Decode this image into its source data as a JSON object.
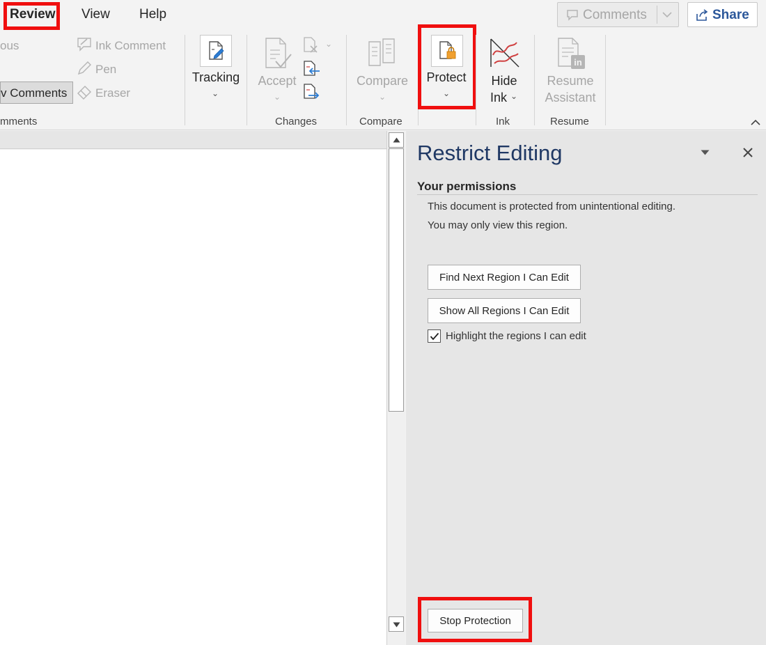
{
  "ribbon": {
    "tabs": {
      "review": "Review",
      "view": "View",
      "help": "Help"
    },
    "comments_button": "Comments",
    "share_button": "Share",
    "comments_group": {
      "prev_partial": "ous",
      "show_comments_partial": "v Comments",
      "ink_comment": "Ink Comment",
      "pen": "Pen",
      "eraser": "Eraser",
      "label_partial": "mments"
    },
    "tracking": {
      "label": "Tracking"
    },
    "changes": {
      "accept": "Accept",
      "label": "Changes"
    },
    "compare": {
      "button": "Compare",
      "label": "Compare"
    },
    "protect": {
      "button": "Protect"
    },
    "ink": {
      "hide_line1": "Hide",
      "hide_line2": "Ink",
      "label": "Ink"
    },
    "resume": {
      "line1": "Resume",
      "line2": "Assistant",
      "label": "Resume"
    }
  },
  "pane": {
    "title": "Restrict Editing",
    "subtitle": "Your permissions",
    "text1": "This document is protected from unintentional editing.",
    "text2": "You may only view this region.",
    "find_next_button": "Find Next Region I Can Edit",
    "show_all_button": "Show All Regions I Can Edit",
    "highlight_label": "Highlight the regions I can edit",
    "highlight_checked": true,
    "stop_button": "Stop Protection"
  },
  "colors": {
    "highlight": "#f00f0f",
    "title": "#1f3864",
    "accent": "#2b579a"
  }
}
